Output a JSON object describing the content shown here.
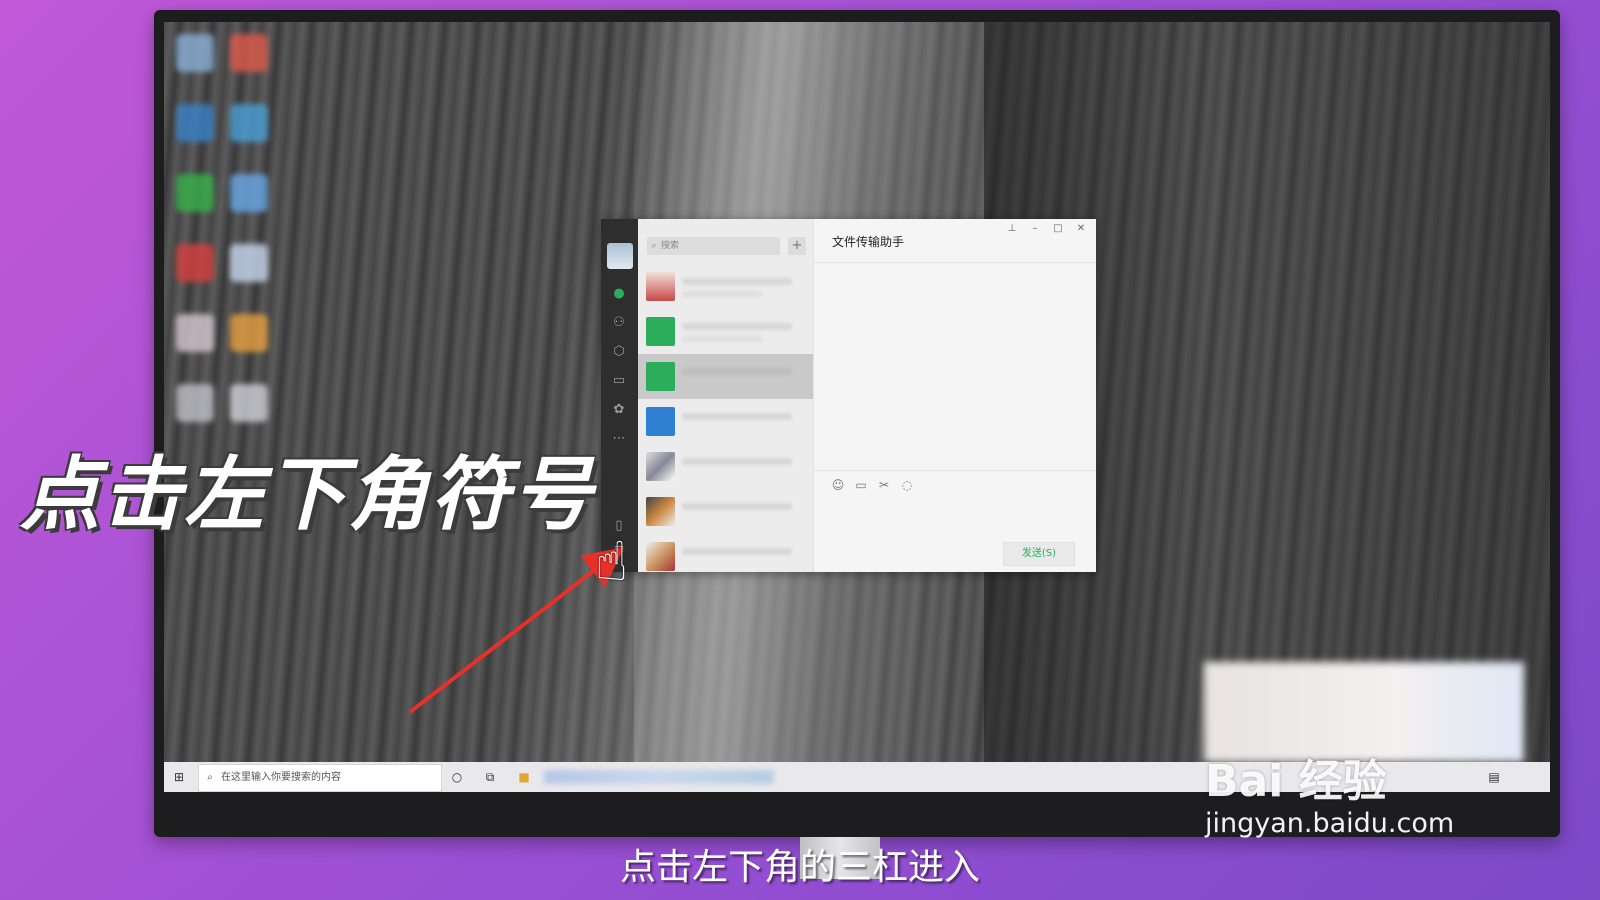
{
  "wechat": {
    "search_placeholder": "搜索",
    "add_symbol": "+",
    "chat_title": "文件传输助手",
    "send_button": "发送(S)",
    "window_controls": [
      "pin-icon",
      "minimize-icon",
      "maximize-icon",
      "close-icon"
    ],
    "sidebar_icons": [
      "chat-icon",
      "contacts-icon",
      "collections-icon",
      "files-icon",
      "moments-icon",
      "more-icon",
      "phone-icon",
      "menu-icon"
    ],
    "toolbar_icons": [
      "emoji-icon",
      "folder-icon",
      "scissors-icon",
      "chat-bubble-icon"
    ]
  },
  "overlay": {
    "instruction": "点击左下角符号"
  },
  "taskbar": {
    "search_placeholder": "在这里输入你要搜索的内容"
  },
  "watermark": {
    "logo": "Bai 经验",
    "site": "jingyan.baidu.com"
  },
  "subtitle": "点击左下角的三杠进入",
  "colors": {
    "accent_green": "#2bad5a",
    "wechat_sidebar": "#2e2e2e",
    "background_purple": "#b055d6"
  }
}
